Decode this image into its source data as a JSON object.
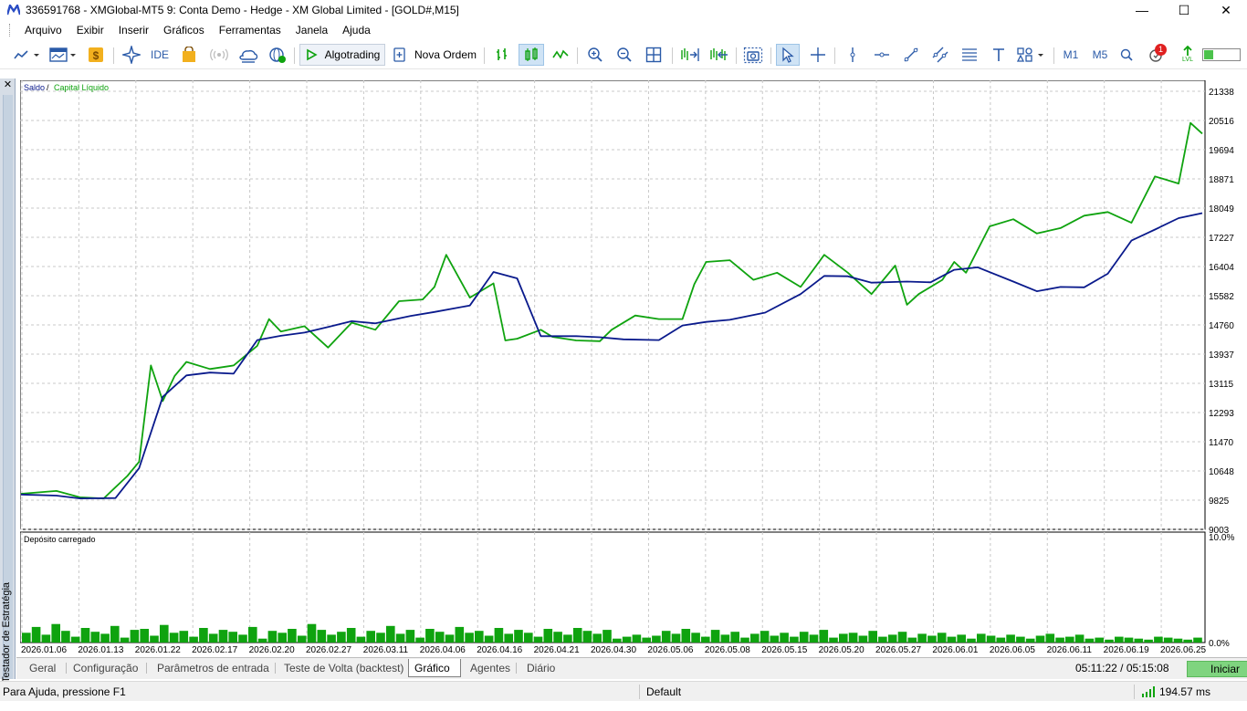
{
  "window": {
    "title": "336591768 - XMGlobal-MT5 9: Conta Demo - Hedge - XM Global Limited - [GOLD#,M15]",
    "controls": [
      "—",
      "☐",
      "✕"
    ]
  },
  "menu": [
    "Arquivo",
    "Exibir",
    "Inserir",
    "Gráficos",
    "Ferramentas",
    "Janela",
    "Ajuda"
  ],
  "toolbar": {
    "ide_label": "IDE",
    "algotrading_label": "Algotrading",
    "new_order_label": "Nova Ordem",
    "m1_label": "M1",
    "m5_label": "M5",
    "notification_count": "1",
    "lvl_label": "LVL"
  },
  "side_panel": {
    "label": "Testador de Estratégia",
    "close": "✕"
  },
  "chart_data": [
    {
      "type": "line",
      "legend": {
        "balance": "Saldo",
        "separator": " / ",
        "equity": "Capital Líquido"
      },
      "colors": {
        "balance": "#0a1a8c",
        "equity": "#0fa30f"
      },
      "y_ticks": [
        "21338",
        "20516",
        "19694",
        "18871",
        "18049",
        "17227",
        "16404",
        "15582",
        "14760",
        "13937",
        "13115",
        "12293",
        "11470",
        "10648",
        "9825",
        "9003"
      ],
      "ylim": [
        9003,
        21338
      ],
      "grid": true,
      "series": [
        {
          "name": "Saldo",
          "x": [
            0,
            3,
            5,
            8,
            10,
            12,
            14,
            16,
            18,
            20,
            22,
            24,
            26,
            28,
            30,
            33,
            35,
            38,
            40,
            42,
            44,
            45,
            47,
            49,
            51,
            54,
            56,
            58,
            60,
            63,
            66,
            68,
            70,
            72,
            75,
            77,
            79,
            81,
            84,
            86,
            88,
            90,
            92,
            94,
            96,
            98,
            100
          ],
          "y": [
            9980,
            9950,
            9870,
            9880,
            10720,
            12720,
            13320,
            13400,
            13370,
            14310,
            14430,
            14520,
            14680,
            14840,
            14780,
            14990,
            15100,
            15280,
            16220,
            16040,
            14420,
            14420,
            14420,
            14390,
            14330,
            14310,
            14720,
            14820,
            14880,
            15080,
            15600,
            16110,
            16100,
            15920,
            15950,
            15930,
            16280,
            16350,
            15950,
            15680,
            15800,
            15790,
            16170,
            17100,
            17410,
            17730,
            17870
          ]
        },
        {
          "name": "Capital Líquido",
          "x": [
            0,
            3,
            5,
            7,
            9,
            10,
            11,
            12,
            13,
            14,
            16,
            18,
            20,
            21,
            22,
            24,
            26,
            28,
            30,
            32,
            34,
            35,
            36,
            38,
            40,
            41,
            42,
            44,
            45,
            47,
            49,
            50,
            52,
            54,
            56,
            57,
            58,
            60,
            62,
            64,
            66,
            68,
            70,
            72,
            74,
            75,
            76,
            78,
            79,
            80,
            82,
            84,
            86,
            88,
            90,
            92,
            94,
            96,
            98,
            99,
            100
          ],
          "y": [
            10000,
            10080,
            9900,
            9870,
            10500,
            10900,
            13600,
            12600,
            13300,
            13700,
            13500,
            13600,
            14150,
            14900,
            14550,
            14700,
            14100,
            14800,
            14600,
            15400,
            15450,
            15800,
            16700,
            15500,
            15900,
            14300,
            14350,
            14600,
            14400,
            14300,
            14280,
            14600,
            15000,
            14900,
            14900,
            15880,
            16500,
            16550,
            16000,
            16200,
            15800,
            16700,
            16200,
            15600,
            16400,
            15300,
            15600,
            16000,
            16500,
            16200,
            17500,
            17700,
            17300,
            17450,
            17800,
            17900,
            17600,
            18900,
            18700,
            20400,
            20100
          ]
        }
      ]
    },
    {
      "type": "bar",
      "title": "Depósito carregado",
      "y_ticks": [
        "10.0%",
        "0.0%"
      ],
      "ylim": [
        0,
        10
      ],
      "grid": true,
      "color": "#0fa30f",
      "x_ticks": [
        "2026.01.06",
        "2026.01.13",
        "2026.01.22",
        "2026.02.17",
        "2026.02.20",
        "2026.02.27",
        "2026.03.11",
        "2026.04.06",
        "2026.04.16",
        "2026.04.21",
        "2026.04.30",
        "2026.05.06",
        "2026.05.08",
        "2026.05.15",
        "2026.05.20",
        "2026.05.27",
        "2026.06.01",
        "2026.06.05",
        "2026.06.11",
        "2026.06.19",
        "2026.06.25"
      ],
      "values": [
        1.0,
        1.6,
        0.8,
        1.9,
        1.2,
        0.6,
        1.5,
        1.1,
        0.9,
        1.7,
        0.5,
        1.3,
        1.4,
        0.7,
        1.8,
        1.0,
        1.2,
        0.6,
        1.5,
        0.9,
        1.3,
        1.1,
        0.8,
        1.6,
        0.4,
        1.2,
        1.0,
        1.4,
        0.7,
        1.9,
        1.3,
        0.8,
        1.1,
        1.5,
        0.6,
        1.2,
        1.0,
        1.7,
        0.9,
        1.3,
        0.5,
        1.4,
        1.1,
        0.8,
        1.6,
        1.0,
        1.2,
        0.7,
        1.5,
        0.9,
        1.3,
        1.0,
        0.6,
        1.4,
        1.1,
        0.8,
        1.5,
        1.2,
        0.9,
        1.3,
        0.4,
        0.6,
        0.8,
        0.5,
        0.7,
        1.2,
        0.9,
        1.4,
        1.0,
        0.6,
        1.3,
        0.8,
        1.1,
        0.5,
        0.9,
        1.2,
        0.7,
        1.0,
        0.6,
        1.1,
        0.8,
        1.3,
        0.5,
        0.9,
        1.0,
        0.7,
        1.2,
        0.6,
        0.8,
        1.1,
        0.5,
        0.9,
        0.7,
        1.0,
        0.6,
        0.8,
        0.4,
        0.9,
        0.7,
        0.5,
        0.8,
        0.6,
        0.4,
        0.7,
        0.9,
        0.5,
        0.6,
        0.8,
        0.4,
        0.5,
        0.3,
        0.6,
        0.5,
        0.4,
        0.3,
        0.6,
        0.5,
        0.4,
        0.3,
        0.5
      ]
    }
  ],
  "bottom_tabs": [
    "Geral",
    "Configuração",
    "Parâmetros de entrada",
    "Teste de Volta (backtest)",
    "Gráfico",
    "Agentes",
    "Diário"
  ],
  "active_tab": "Gráfico",
  "time_info": "05:11:22 / 05:15:08",
  "start_button": "Iniciar",
  "status": {
    "help": "Para Ajuda, pressione F1",
    "profile": "Default",
    "ping": "194.57 ms"
  }
}
